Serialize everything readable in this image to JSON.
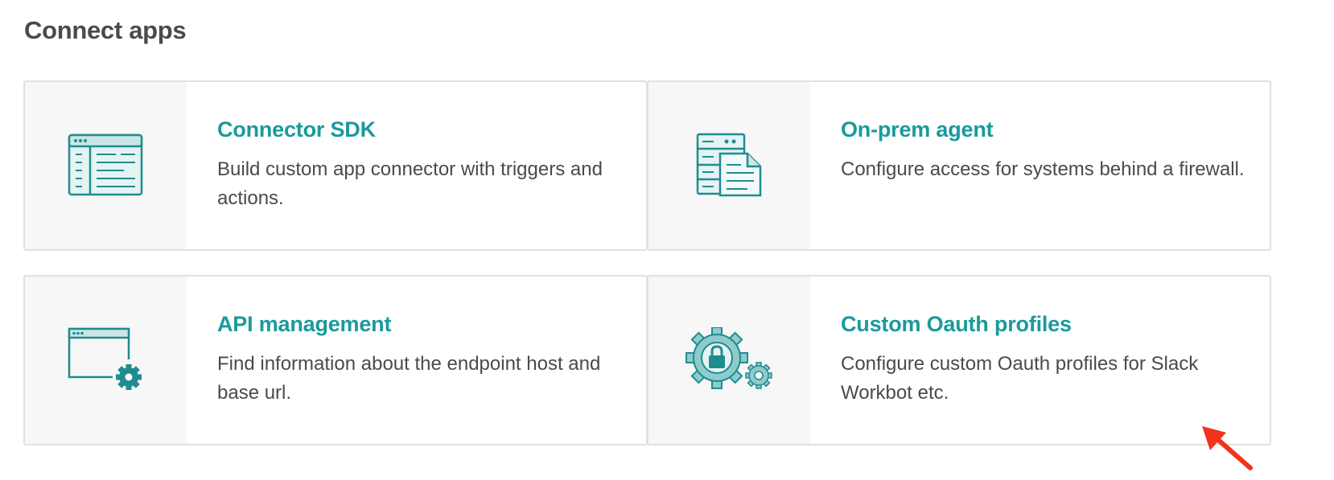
{
  "page": {
    "title": "Connect apps"
  },
  "cards": [
    {
      "title": "Connector SDK",
      "description": "Build custom app connector with triggers and actions.",
      "icon": "connector-sdk-icon"
    },
    {
      "title": "On-prem agent",
      "description": "Configure access for systems behind a firewall.",
      "icon": "on-prem-agent-icon"
    },
    {
      "title": "API management",
      "description": "Find information about the endpoint host and base url.",
      "icon": "api-management-icon"
    },
    {
      "title": "Custom Oauth profiles",
      "description": "Configure custom Oauth profiles for Slack Workbot etc.",
      "icon": "oauth-gears-lock-icon"
    }
  ],
  "colors": {
    "accent": "#1a9a9c",
    "icon_teal": "#1f8c8f",
    "text": "#4a4a4a",
    "card_border": "#e1e1e1",
    "icon_bg": "#f7f7f7",
    "annotation_arrow": "#f2331c"
  }
}
